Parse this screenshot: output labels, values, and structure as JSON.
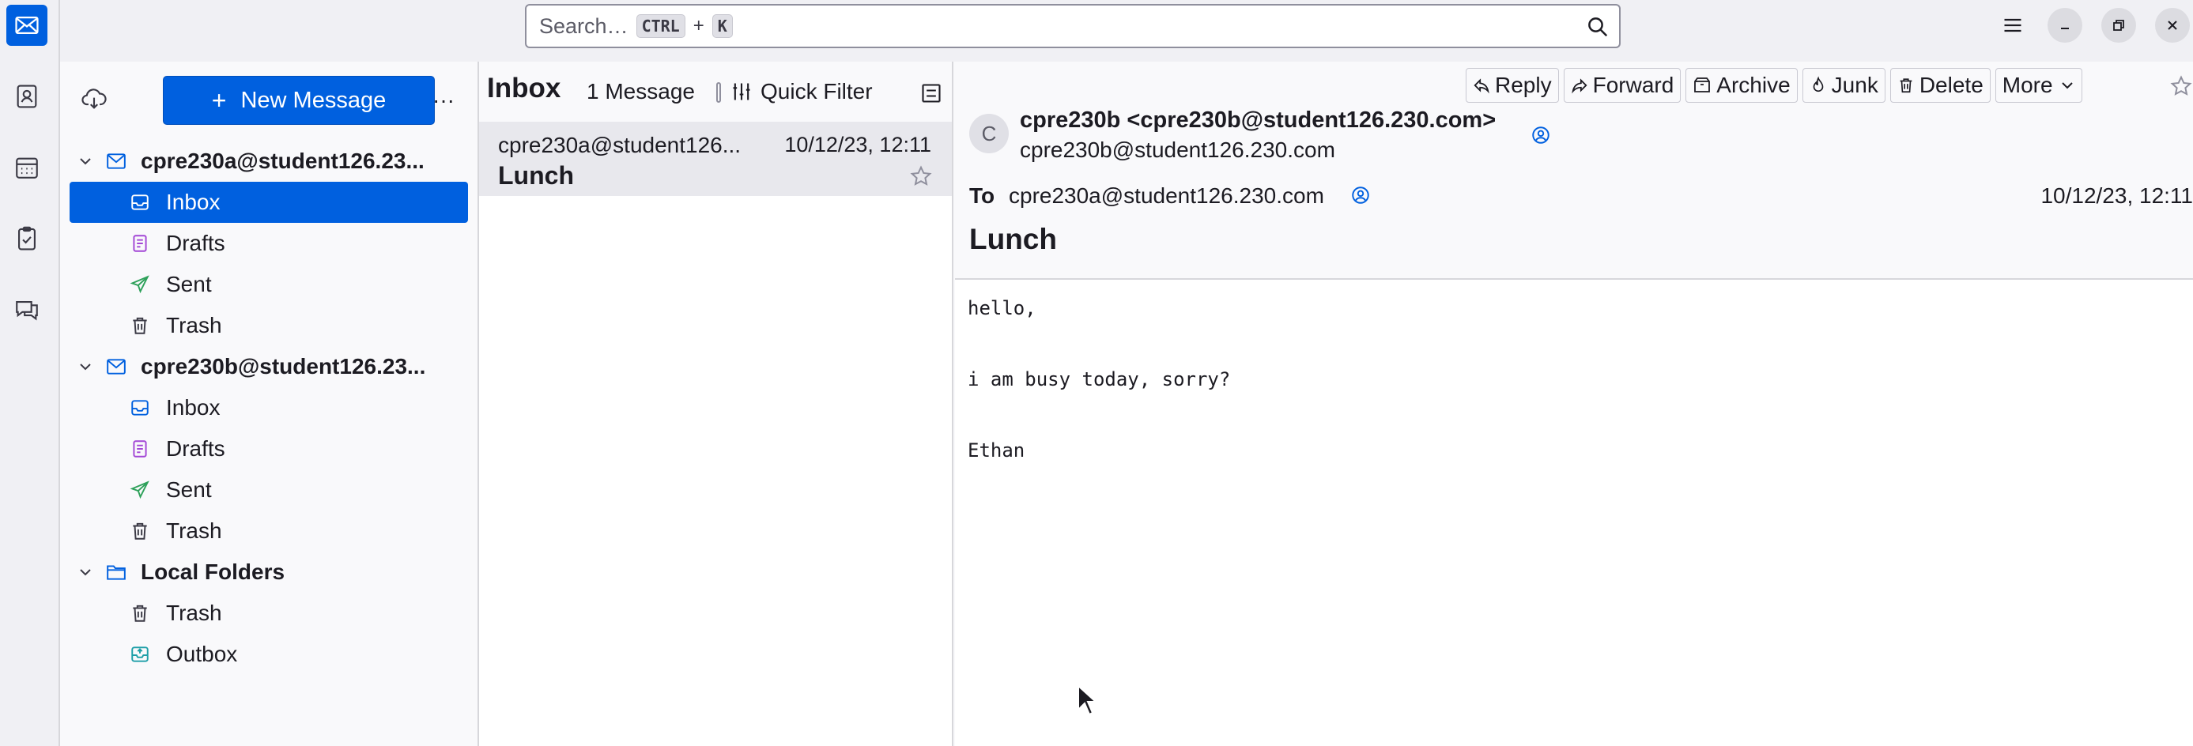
{
  "app": {
    "accent": "#0060df"
  },
  "spaces": [
    {
      "name": "mail-icon",
      "active": true
    },
    {
      "name": "address-book-icon",
      "active": false
    },
    {
      "name": "calendar-icon",
      "active": false
    },
    {
      "name": "tasks-icon",
      "active": false
    },
    {
      "name": "chat-icon",
      "active": false
    }
  ],
  "search": {
    "placeholder": "Search…",
    "shortcut_key1": "CTRL",
    "shortcut_plus": "+",
    "shortcut_key2": "K"
  },
  "folder_pane": {
    "new_message_label": "New Message",
    "more_label": "···",
    "accounts": [
      {
        "label": "cpre230a@student126.23...",
        "folders": [
          {
            "label": "Inbox",
            "icon": "inbox-icon",
            "selected": true
          },
          {
            "label": "Drafts",
            "icon": "drafts-icon"
          },
          {
            "label": "Sent",
            "icon": "sent-icon"
          },
          {
            "label": "Trash",
            "icon": "trash-icon"
          }
        ]
      },
      {
        "label": "cpre230b@student126.23...",
        "folders": [
          {
            "label": "Inbox",
            "icon": "inbox-icon"
          },
          {
            "label": "Drafts",
            "icon": "drafts-icon"
          },
          {
            "label": "Sent",
            "icon": "sent-icon"
          },
          {
            "label": "Trash",
            "icon": "trash-icon"
          }
        ]
      },
      {
        "label": "Local Folders",
        "folders": [
          {
            "label": "Trash",
            "icon": "trash-icon"
          },
          {
            "label": "Outbox",
            "icon": "outbox-icon"
          }
        ]
      }
    ]
  },
  "thread_pane": {
    "folder_title": "Inbox",
    "message_count": "1 Message",
    "quick_filter_label": "Quick Filter",
    "messages": [
      {
        "sender": "cpre230a@student126...",
        "date": "10/12/23, 12:11",
        "subject": "Lunch"
      }
    ]
  },
  "message": {
    "actions": {
      "reply": "Reply",
      "forward": "Forward",
      "archive": "Archive",
      "junk": "Junk",
      "delete": "Delete",
      "more": "More"
    },
    "avatar_letter": "C",
    "from_name": "cpre230b <cpre230b@student126.230.com>",
    "from_address": "cpre230b@student126.230.com",
    "to_label": "To",
    "to_address": "cpre230a@student126.230.com",
    "date": "10/12/23, 12:11",
    "subject": "Lunch",
    "body": [
      "hello,",
      "",
      "i am busy today, sorry?",
      "",
      "Ethan"
    ]
  }
}
